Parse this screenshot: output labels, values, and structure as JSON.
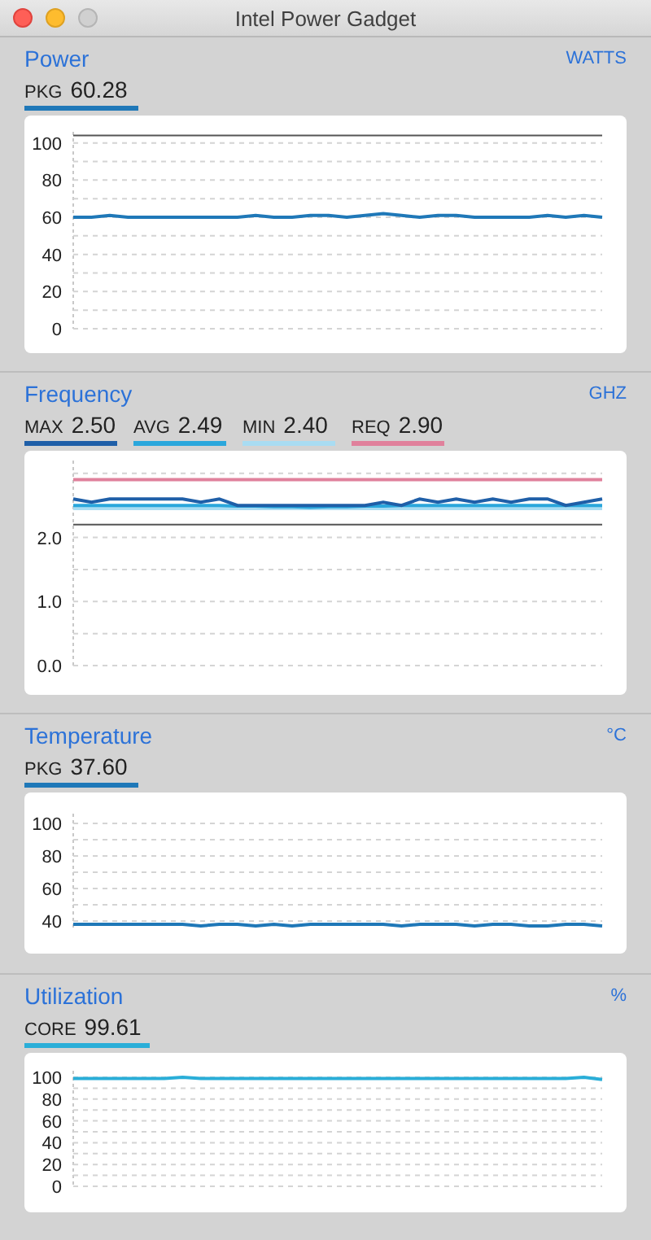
{
  "window": {
    "title": "Intel Power Gadget"
  },
  "sections": [
    {
      "title": "Power",
      "unit": "WATTS",
      "readings": [
        "60.28"
      ],
      "chart_data": {
        "type": "line",
        "grid": true,
        "ylim": [
          0,
          106
        ],
        "yticks": [
          0,
          20,
          40,
          60,
          80,
          100
        ],
        "ref_lines": [
          {
            "axis": "y",
            "value": 104
          }
        ],
        "series": [
          {
            "name": "PKG",
            "color": "#1f78b8",
            "values": [
              60,
              60,
              61,
              60,
              60,
              60,
              60,
              60,
              60,
              60,
              61,
              60,
              60,
              61,
              61,
              60,
              61,
              62,
              61,
              60,
              61,
              61,
              60,
              60,
              60,
              60,
              61,
              60,
              61,
              60
            ]
          }
        ]
      }
    },
    {
      "title": "Frequency",
      "unit": "GHZ",
      "readings": [
        "2.50",
        "2.49",
        "2.40",
        "2.90"
      ],
      "chart_data": {
        "type": "line",
        "grid": true,
        "ylim": [
          0,
          3.2
        ],
        "yticks": [
          {
            "value": 0,
            "label": "0.0"
          },
          {
            "value": 1,
            "label": "1.0"
          },
          {
            "value": 2,
            "label": "2.0"
          }
        ],
        "ref_lines": [
          {
            "axis": "y",
            "value": 2.2
          }
        ],
        "series": [
          {
            "name": "MAX",
            "color": "#1f5fa8",
            "values": [
              2.6,
              2.55,
              2.6,
              2.6,
              2.6,
              2.6,
              2.6,
              2.55,
              2.6,
              2.5,
              2.5,
              2.5,
              2.5,
              2.5,
              2.5,
              2.5,
              2.5,
              2.55,
              2.5,
              2.6,
              2.55,
              2.6,
              2.55,
              2.6,
              2.55,
              2.6,
              2.6,
              2.5,
              2.55,
              2.6
            ]
          },
          {
            "name": "AVG",
            "color": "#2aa7dc",
            "values": [
              2.5,
              2.5,
              2.5,
              2.5,
              2.5,
              2.5,
              2.5,
              2.5,
              2.5,
              2.49,
              2.49,
              2.48,
              2.48,
              2.47,
              2.48,
              2.48,
              2.49,
              2.49,
              2.5,
              2.5,
              2.5,
              2.5,
              2.5,
              2.5,
              2.5,
              2.5,
              2.5,
              2.5,
              2.5,
              2.5
            ]
          },
          {
            "name": "MIN",
            "color": "#a9dcf2",
            "values": [
              2.45,
              2.45,
              2.45,
              2.45,
              2.45,
              2.45,
              2.45,
              2.45,
              2.45,
              2.45,
              2.45,
              2.45,
              2.45,
              2.45,
              2.45,
              2.45,
              2.45,
              2.45,
              2.45,
              2.45,
              2.45,
              2.45,
              2.45,
              2.45,
              2.45,
              2.45,
              2.45,
              2.45,
              2.45,
              2.45
            ]
          },
          {
            "name": "REQ",
            "color": "#e0819c",
            "values": [
              2.9,
              2.9,
              2.9,
              2.9,
              2.9,
              2.9,
              2.9,
              2.9,
              2.9,
              2.9,
              2.9,
              2.9,
              2.9,
              2.9,
              2.9,
              2.9,
              2.9,
              2.9,
              2.9,
              2.9,
              2.9,
              2.9,
              2.9,
              2.9,
              2.9,
              2.9,
              2.9,
              2.9,
              2.9,
              2.9
            ]
          }
        ]
      }
    },
    {
      "title": "Temperature",
      "unit": "°C",
      "readings": [
        "37.60"
      ],
      "chart_data": {
        "type": "line",
        "grid": true,
        "ylim": [
          34,
          106
        ],
        "yticks": [
          40,
          60,
          80,
          100
        ],
        "series": [
          {
            "name": "PKG",
            "color": "#1f78b8",
            "values": [
              38,
              38,
              38,
              38,
              38,
              38,
              38,
              37,
              38,
              38,
              37,
              38,
              37,
              38,
              38,
              38,
              38,
              38,
              37,
              38,
              38,
              38,
              37,
              38,
              38,
              37,
              37,
              38,
              38,
              37
            ]
          }
        ]
      }
    },
    {
      "title": "Utilization",
      "unit": "%",
      "readings": [
        "99.61"
      ],
      "chart_data": {
        "type": "line",
        "grid": true,
        "ylim": [
          0,
          106
        ],
        "yticks": [
          0,
          20,
          40,
          60,
          80,
          100
        ],
        "series": [
          {
            "name": "CORE",
            "color": "#2aaed8",
            "values": [
              99,
              99,
              99,
              99,
              99,
              99,
              100,
              99,
              99,
              99,
              99,
              99,
              99,
              99,
              99,
              99,
              99,
              99,
              99,
              99,
              99,
              99,
              99,
              99,
              99,
              99,
              99,
              99,
              100,
              98
            ]
          }
        ]
      }
    }
  ]
}
